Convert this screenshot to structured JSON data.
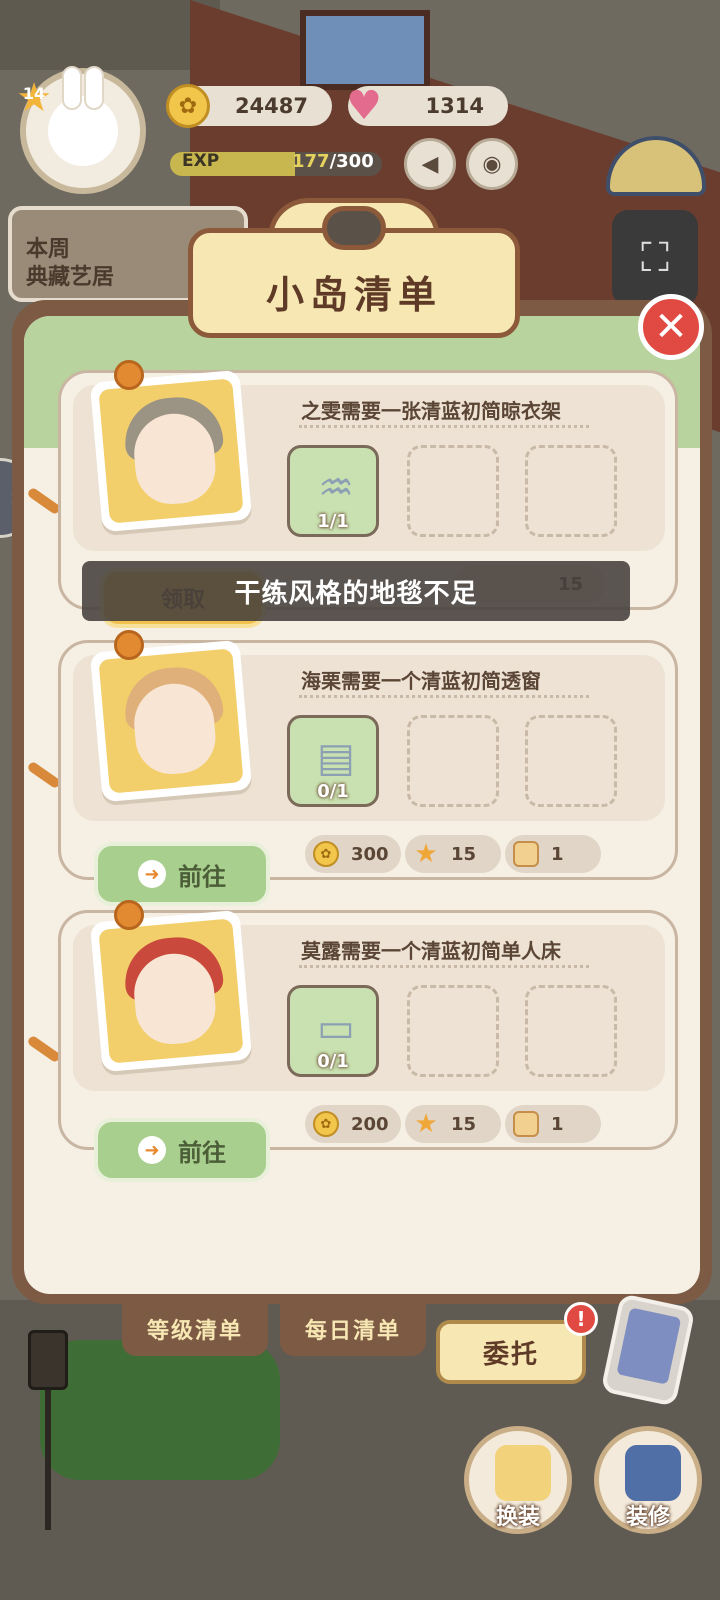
{
  "hud": {
    "level": "14",
    "coins": "24487",
    "hearts": "1314",
    "exp_label": "EXP",
    "exp_current": "177",
    "exp_max": "/300",
    "exp_progress": 0.59,
    "weekly_label": "本周\n典藏艺居"
  },
  "panel": {
    "title": "小岛清单",
    "close_icon": "close-icon"
  },
  "tasks": [
    {
      "title": "之雯需要一张清蓝初简晾衣架",
      "item_count": "1/1",
      "claim_label": "领取",
      "reward_partial": "15"
    },
    {
      "title": "海栗需要一个清蓝初简透窗",
      "item_count": "0/1",
      "goto_label": "前往",
      "rewards": {
        "coins": "300",
        "stars": "15",
        "boxes": "1"
      }
    },
    {
      "title": "莫露需要一个清蓝初简单人床",
      "item_count": "0/1",
      "goto_label": "前往",
      "rewards": {
        "coins": "200",
        "stars": "15",
        "boxes": "1"
      }
    }
  ],
  "toast": "干练风格的地毯不足",
  "tabs": {
    "level_list": "等级清单",
    "daily_list": "每日清单",
    "commission": "委托",
    "commission_badge": "!"
  },
  "bottom": {
    "dress_up": "换装",
    "decorate": "装修"
  },
  "colors": {
    "panel_brown": "#7c5a44",
    "goto_green": "#a9cf8e",
    "close_red": "#e14a43",
    "title_cream": "#f6e7b3"
  }
}
